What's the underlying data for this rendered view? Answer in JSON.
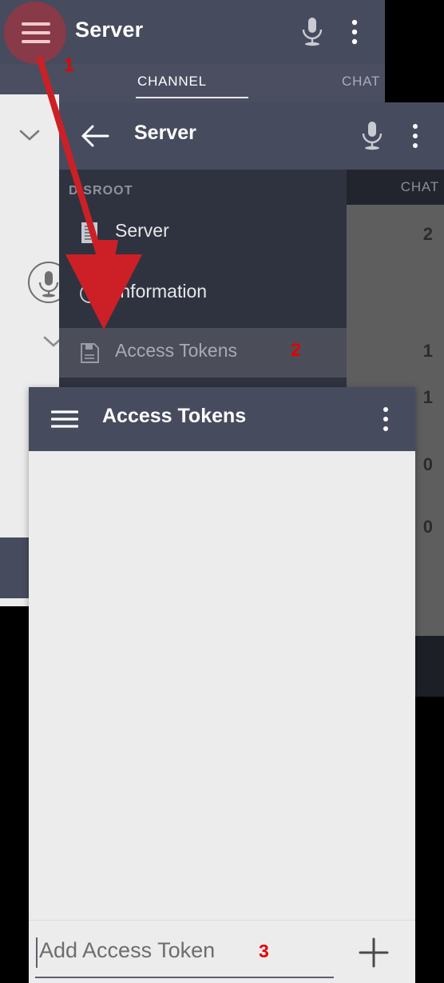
{
  "top_bar": {
    "title": "Server",
    "mic_icon": "microphone-icon",
    "overflow_icon": "overflow-menu-icon",
    "hamburger_icon": "hamburger-menu-icon"
  },
  "tabs": [
    {
      "label": "CHANNEL",
      "active": true
    },
    {
      "label": "CHAT",
      "active": false
    }
  ],
  "second_bar": {
    "title": "Server",
    "back_icon": "back-arrow-icon",
    "mic_icon": "microphone-icon",
    "overflow_icon": "overflow-menu-icon"
  },
  "right_panel": {
    "chat_label": "CHAT",
    "counters": [
      "2",
      "1",
      "1",
      "0",
      "0"
    ]
  },
  "drawer": {
    "section_label": "DISROOT",
    "items": [
      {
        "label": "Server",
        "icon": "server-list-icon",
        "active": false
      },
      {
        "label": "Information",
        "icon": "info-circle-icon",
        "active": false
      },
      {
        "label": "Access Tokens",
        "icon": "save-floppy-icon",
        "active": true
      }
    ]
  },
  "access_tokens_screen": {
    "title": "Access Tokens",
    "hamburger_icon": "hamburger-menu-icon",
    "overflow_icon": "overflow-menu-icon",
    "list_items": []
  },
  "bottom_input": {
    "placeholder": "Add Access Token",
    "value": "",
    "add_icon": "plus-icon"
  },
  "left_rail": {
    "chevron_icon": "chevron-down-icon",
    "mic_icon": "microphone-circle-icon"
  },
  "annotations": [
    {
      "number": "1",
      "target": "hamburger-menu-icon"
    },
    {
      "number": "2",
      "target": "access-tokens-drawer-item"
    },
    {
      "number": "3",
      "target": "add-access-token-input"
    }
  ],
  "colors": {
    "appbar": "#474b5e",
    "drawer_bg": "#2f3340",
    "drawer_active": "#4b4e58",
    "content_bg": "#ececec",
    "annotation_red": "#e60000",
    "highlight_circle": "#b0303e"
  }
}
